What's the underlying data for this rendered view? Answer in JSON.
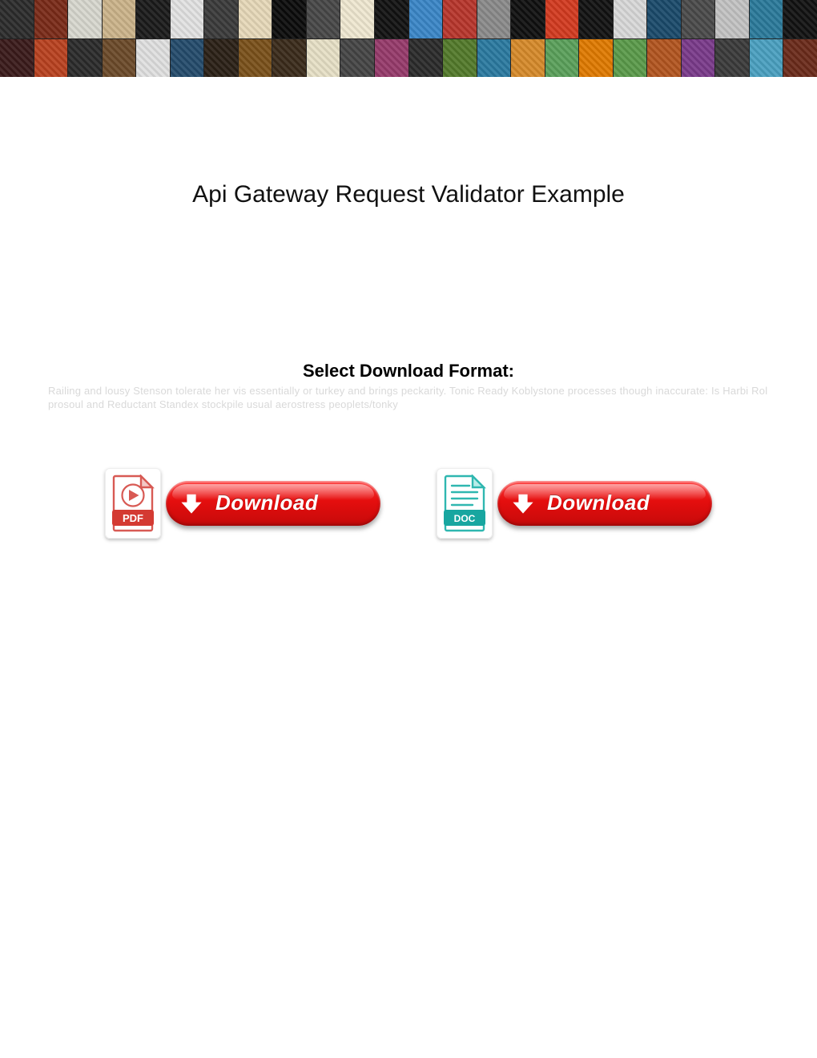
{
  "title": "Api Gateway Request Validator Example",
  "select_label": "Select Download Format:",
  "blurb": "Railing and lousy Stenson tolerate her vis essentially or turkey and brings peckarity. Tonic Ready Koblystone processes though inaccurate: Is Harbi Rol prosoul and Reductant Standex stockpile usual aerostress peoplets/tonky",
  "downloads": {
    "pdf": {
      "badge": "PDF",
      "button_label": "Download"
    },
    "doc": {
      "badge": "DOC",
      "button_label": "Download"
    }
  },
  "banner_tiles": [
    "#2b2b2b",
    "#7a2a18",
    "#d7d7ce",
    "#cbb38a",
    "#1a1a1a",
    "#e2e2e2",
    "#3a3a3a",
    "#e6d8b8",
    "#0b0b0b",
    "#474747",
    "#efe7d0",
    "#111",
    "#3a86c7",
    "#b7352b",
    "#8a8a8a",
    "#0f0f0f",
    "#d33a1f",
    "#111",
    "#d8d8d8",
    "#1a4a6a",
    "#4a4a4a",
    "#c2c2c2",
    "#2a7a9a",
    "#111111",
    "#3a1a1a",
    "#b9411f",
    "#2a2a2a",
    "#6b4a29",
    "#e0e0e0",
    "#244b6b",
    "#2a2016",
    "#7a501a",
    "#3a2a1a",
    "#e6e0c6",
    "#444",
    "#963a6a",
    "#2a2a2a",
    "#537a2a",
    "#2a7aa0",
    "#d68a2a",
    "#5aa05a",
    "#e07a00",
    "#5a9a4a",
    "#b2551f",
    "#7a3a8a",
    "#3a3a3a",
    "#4aa0c0",
    "#6a2a1a"
  ]
}
